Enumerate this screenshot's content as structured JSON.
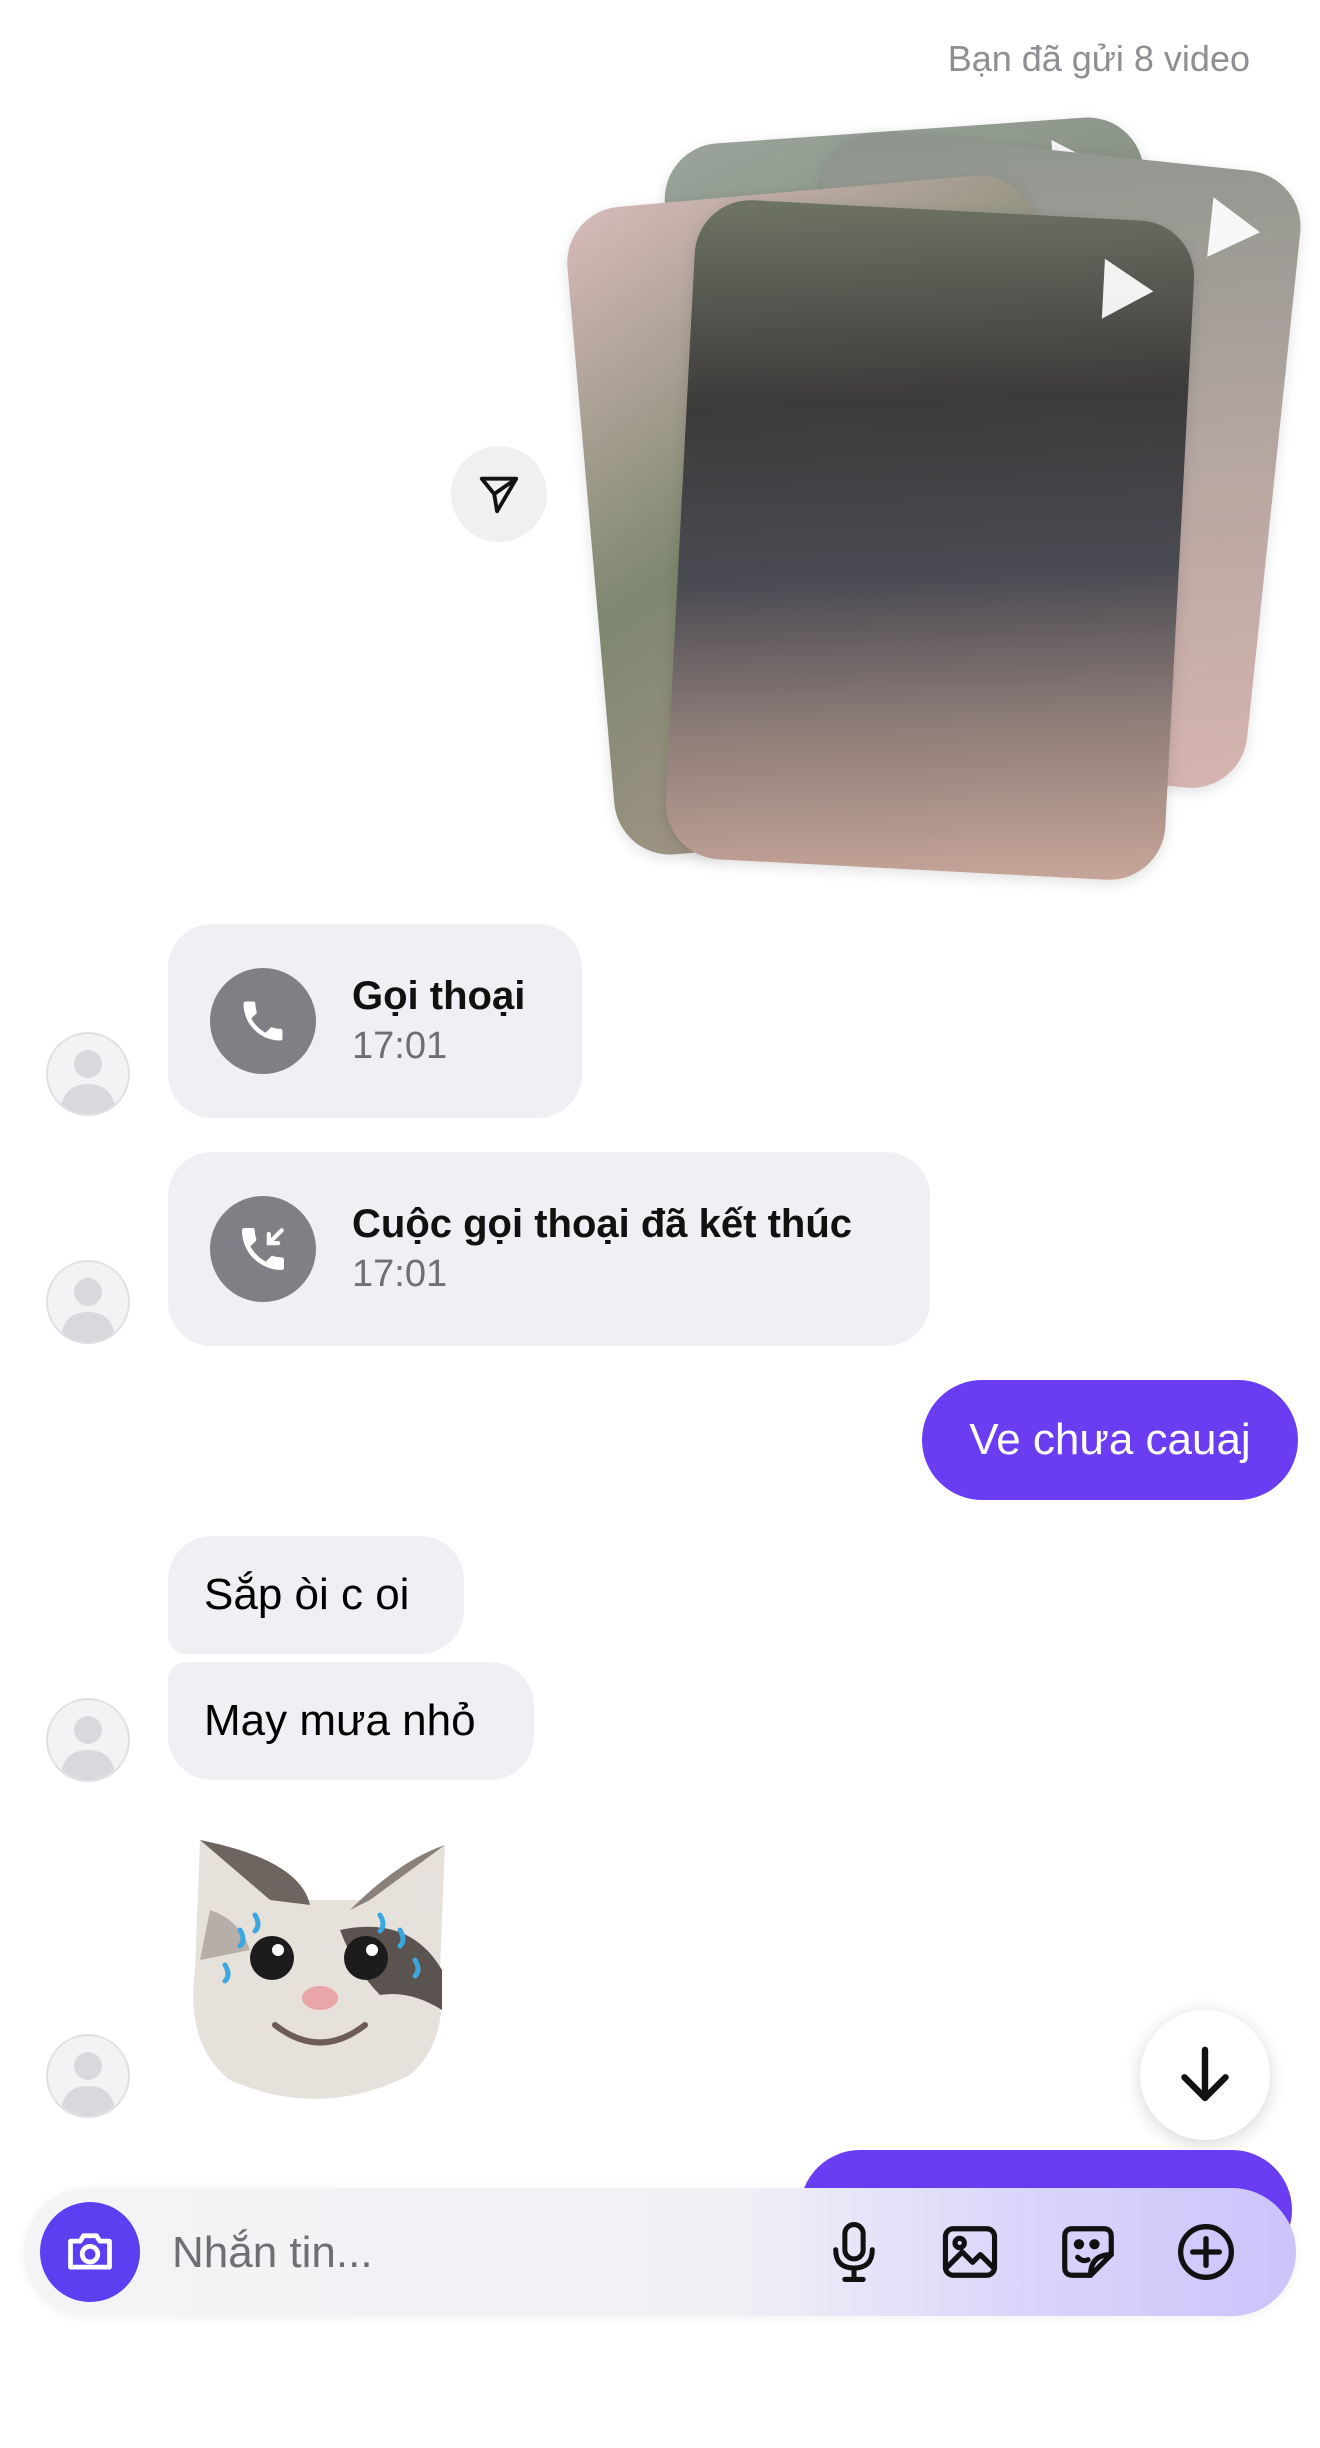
{
  "header": {
    "sent_summary": "Bạn đã gửi 8 video"
  },
  "video_stack": {
    "icon": "play-icon",
    "count_cards": 4
  },
  "share": {
    "icon": "send-icon"
  },
  "calls": [
    {
      "title": "Gọi thoại",
      "time": "17:01",
      "icon": "phone-icon"
    },
    {
      "title": "Cuộc gọi thoại đã kết thúc",
      "time": "17:01",
      "icon": "phone-incoming-icon"
    }
  ],
  "messages": {
    "outgoing_1": "Ve chưa cauaj",
    "incoming_1": "Sắp òi c oi",
    "incoming_2": "May mưa nhỏ"
  },
  "sticker": {
    "name": "crying-cat-sticker"
  },
  "composer": {
    "placeholder": "Nhắn tin...",
    "icons": [
      "camera-icon",
      "microphone-icon",
      "image-icon",
      "sticker-icon",
      "plus-circle-icon"
    ]
  },
  "colors": {
    "accent": "#6a3df2",
    "bubble_in": "#efeff4",
    "muted_text": "#8e8e93"
  }
}
